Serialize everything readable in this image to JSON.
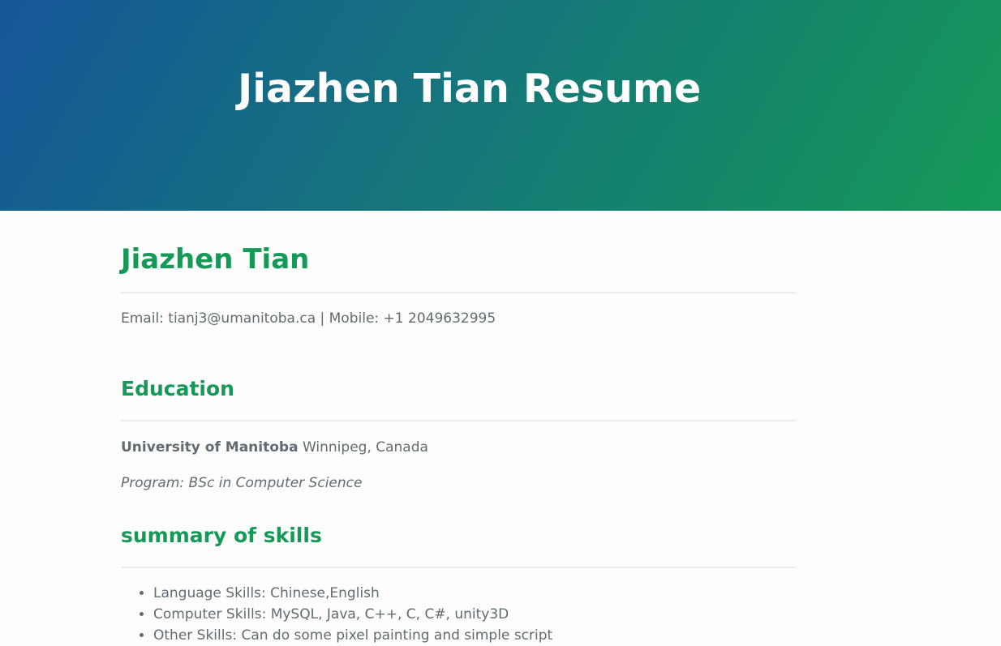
{
  "header": {
    "title": "Jiazhen Tian Resume"
  },
  "main": {
    "name": "Jiazhen Tian",
    "contact": "Email: tianj3@umanitoba.ca | Mobile: +1 2049632995",
    "education": {
      "heading": "Education",
      "school": "University of Manitoba",
      "location": " Winnipeg, Canada",
      "program": "Program: BSc in Computer Science"
    },
    "skills": {
      "heading": "summary of skills",
      "items": [
        "Language Skills: Chinese,English",
        "Computer Skills: MySQL, Java, C++, C, C#, unity3D",
        "Other Skills: Can do some pixel painting and simple script"
      ]
    }
  },
  "colors": {
    "gradient_start": "#155799",
    "gradient_end": "#159957",
    "heading_green": "#159957",
    "body_text": "#606c71",
    "rule": "#e9ebec"
  }
}
